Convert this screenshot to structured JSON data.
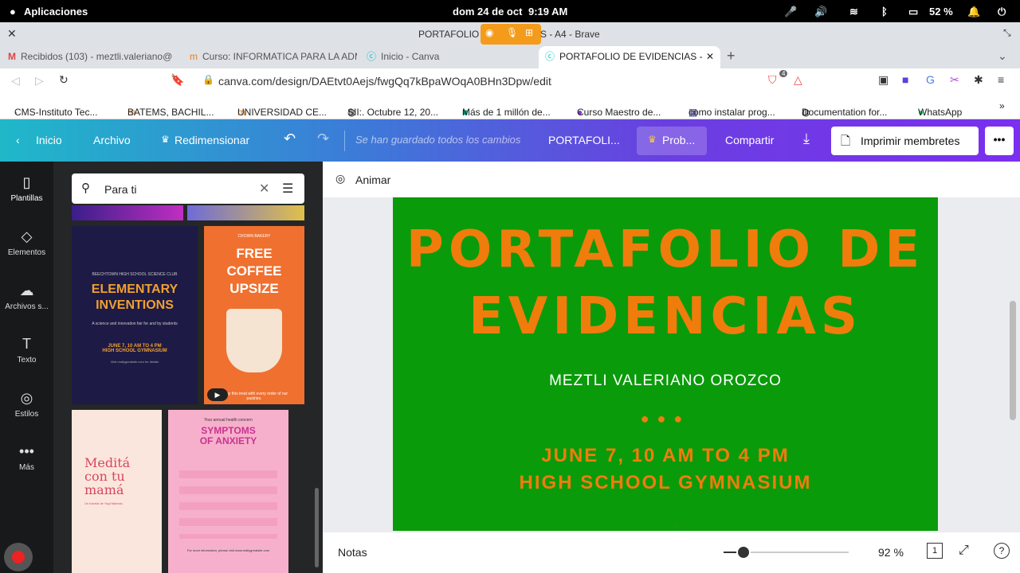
{
  "os": {
    "apps": "Aplicaciones",
    "date": "dom 24 de oct",
    "time": "9:19 AM",
    "battery": "52 %"
  },
  "window": {
    "title_left": "PORTAFOLIO D",
    "title_right": "S - A4 - Brave"
  },
  "tabs": [
    {
      "label": "Recibidos (103) - meztli.valeriano@"
    },
    {
      "label": "Curso: INFORMATICA PARA LA ADM"
    },
    {
      "label": "Inicio - Canva"
    },
    {
      "label": "PORTAFOLIO DE EVIDENCIAS -"
    }
  ],
  "address": {
    "url": "canva.com/design/DAEtvt0Aejs/fwgQq7kBpaWOqA0BHn3Dpw/edit",
    "shield_count": "4"
  },
  "bookmarks": [
    "CMS-Instituto Tec...",
    "BATEMS, BACHIL...",
    "UNIVERSIDAD CE...",
    "SII:. Octubre 12, 20...",
    "Más de 1 millón de...",
    "Curso Maestro de...",
    "como instalar prog...",
    "Documentation for...",
    "WhatsApp"
  ],
  "canva": {
    "back": "Inicio",
    "file": "Archivo",
    "resize": "Redimensionar",
    "saved": "Se han guardado todos los cambios",
    "doc_title": "PORTAFOLI...",
    "try": "Prob...",
    "share": "Compartir",
    "print": "Imprimir membretes"
  },
  "sidenav": [
    {
      "label": "Plantillas",
      "icon": "templates-icon"
    },
    {
      "label": "Elementos",
      "icon": "elements-icon"
    },
    {
      "label": "Archivos s...",
      "icon": "upload-icon"
    },
    {
      "label": "Texto",
      "icon": "text-icon"
    },
    {
      "label": "Estilos",
      "icon": "styles-icon"
    },
    {
      "label": "Más",
      "icon": "more-icon"
    }
  ],
  "panel": {
    "search_value": "Para ti"
  },
  "templates": {
    "t1": {
      "small": "BEECHTOWN HIGH SCHOOL SCIENCE CLUB",
      "title": "ELEMENTARY INVENTIONS",
      "body": "A science and innovation fair for and by students",
      "date": "JUNE 7, 10 AM TO 4 PM",
      "place": "HIGH SCHOOL GYMNASIUM",
      "site": "Visit reallygreatsite.com for details"
    },
    "t2": {
      "brand": "CROWN BAKERY",
      "title": "FREE COFFEE UPSIZE",
      "body": "Enjoy this treat with every order of our pastries."
    },
    "t3": {
      "title": "Meditá con tu mamá",
      "sub": "Un tutorial de Yogi Mamalu"
    },
    "t4": {
      "pre": "Your annual health concern",
      "title": "SYMPTOMS OF ANXIETY",
      "footer": "For more information, please visit www.reallygreatsite.com"
    }
  },
  "editor": {
    "animate": "Animar",
    "notes": "Notas",
    "zoom": "92 %",
    "page_num": "1"
  },
  "design": {
    "title_line1": "PORTAFOLIO DE",
    "title_line2": "EVIDENCIAS",
    "author": "MEZTLI VALERIANO OROZCO",
    "date_line": "JUNE 7, 10 AM TO 4 PM",
    "place_line": "HIGH SCHOOL GYMNASIUM",
    "bg": "#0a9b0a",
    "accent": "#f07c0c"
  }
}
